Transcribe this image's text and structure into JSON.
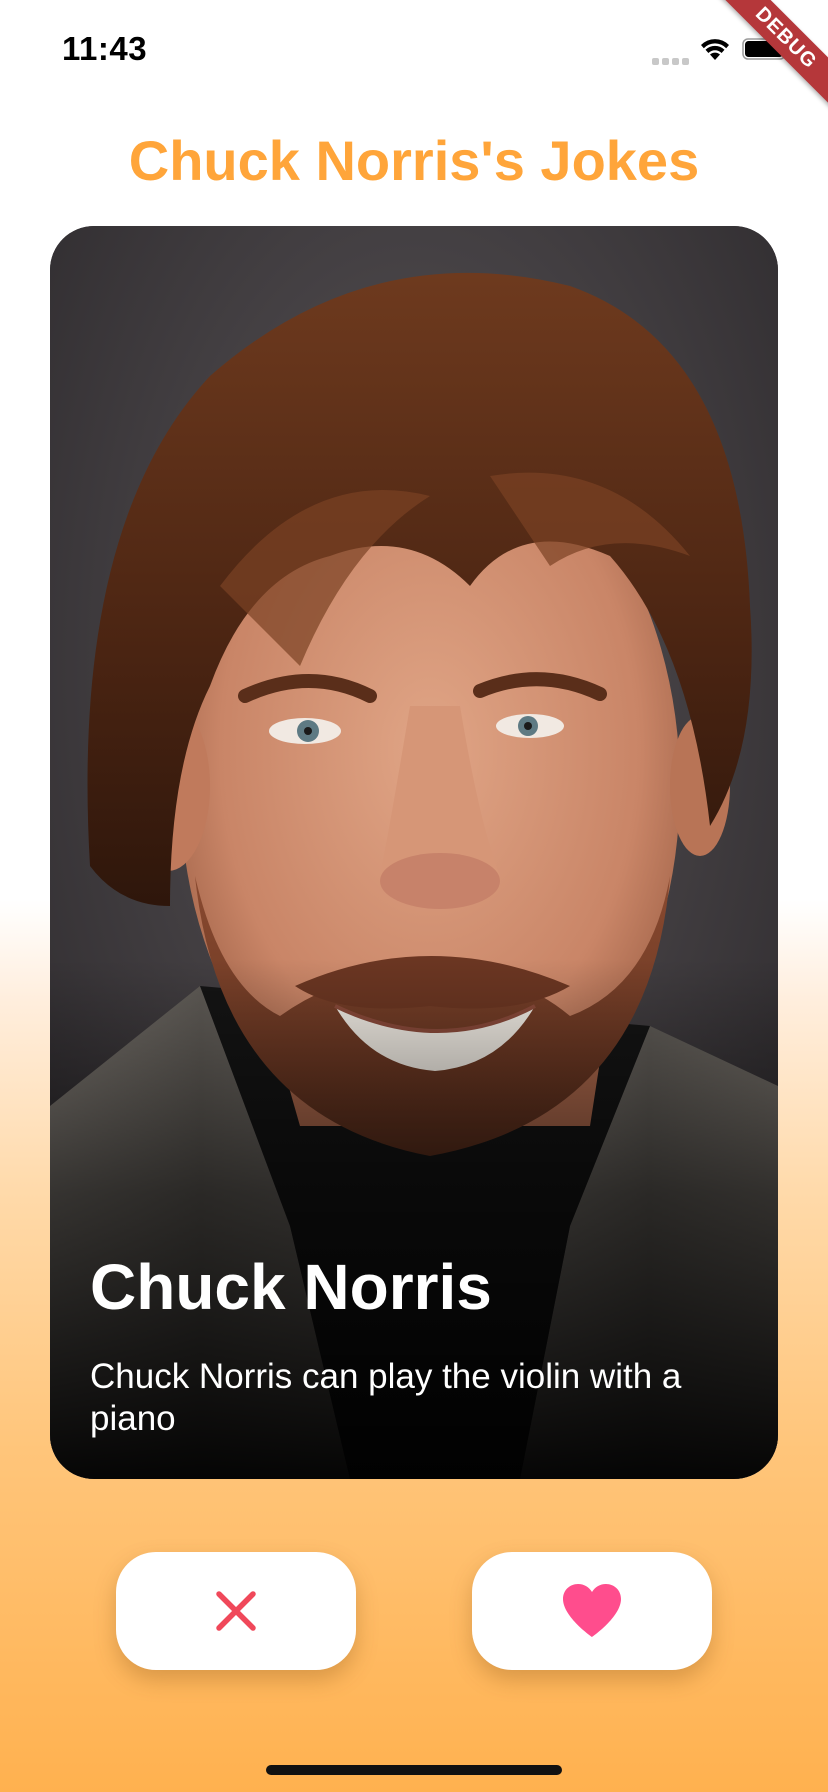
{
  "status_bar": {
    "time": "11:43"
  },
  "debug_banner": "DEBUG",
  "title": "Chuck Norris's Jokes",
  "card": {
    "name": "Chuck Norris",
    "joke": "Chuck Norris can play the violin with a piano"
  },
  "actions": {
    "dislike_icon": "close-icon",
    "like_icon": "heart-icon"
  },
  "colors": {
    "title": "#ffa53a",
    "dislike": "#f0485a",
    "like": "#ff4d8d",
    "debug_ribbon": "#b5373a"
  }
}
